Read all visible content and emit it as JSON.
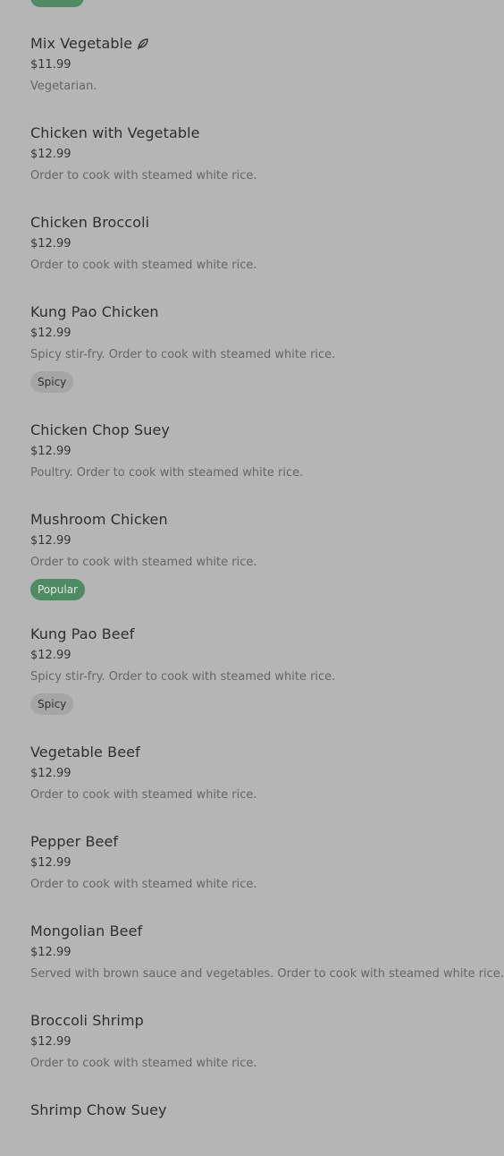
{
  "menu": {
    "items": [
      {
        "name": "Mix Vegetable",
        "price": "$11.99",
        "description": "Vegetarian.",
        "icon": "leaf-icon"
      },
      {
        "name": "Chicken with Vegetable",
        "price": "$12.99",
        "description": "Order to cook with steamed white rice."
      },
      {
        "name": "Chicken Broccoli",
        "price": "$12.99",
        "description": "Order to cook with steamed white rice."
      },
      {
        "name": "Kung Pao Chicken",
        "price": "$12.99",
        "description": "Spicy stir-fry. Order to cook with steamed white rice.",
        "badge": "Spicy"
      },
      {
        "name": "Chicken Chop Suey",
        "price": "$12.99",
        "description": "Poultry. Order to cook with steamed white rice."
      },
      {
        "name": "Mushroom Chicken",
        "price": "$12.99",
        "description": "Order to cook with steamed white rice.",
        "badge": "Popular"
      },
      {
        "name": "Kung Pao Beef",
        "price": "$12.99",
        "description": "Spicy stir-fry. Order to cook with steamed white rice.",
        "badge": "Spicy"
      },
      {
        "name": "Vegetable Beef",
        "price": "$12.99",
        "description": "Order to cook with steamed white rice."
      },
      {
        "name": "Pepper Beef",
        "price": "$12.99",
        "description": "Order to cook with steamed white rice."
      },
      {
        "name": "Mongolian Beef",
        "price": "$12.99",
        "description": "Served with brown sauce and vegetables. Order to cook with steamed white rice."
      },
      {
        "name": "Broccoli Shrimp",
        "price": "$12.99",
        "description": "Order to cook with steamed white rice."
      },
      {
        "name": "Shrimp Chow Suey"
      }
    ]
  },
  "colors": {
    "background": "#b5b5b5",
    "popular_badge": "#4e8a62",
    "spicy_badge": "#a5a5a5"
  }
}
